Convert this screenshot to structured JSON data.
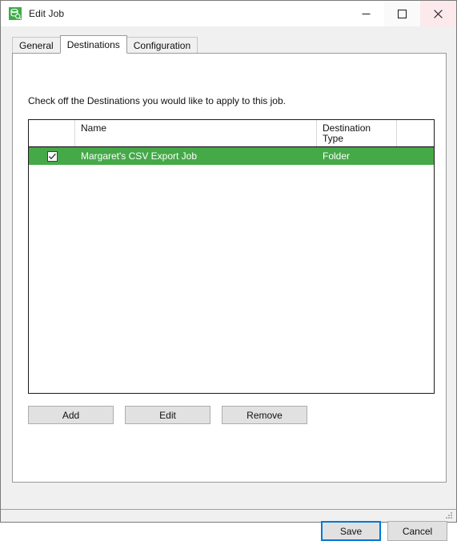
{
  "window": {
    "title": "Edit Job",
    "app_icon": "job-database-icon",
    "controls": {
      "minimize": "minimize-icon",
      "maximize": "maximize-icon",
      "close": "close-icon"
    }
  },
  "colors": {
    "accent_selection": "#45a948",
    "focus_border": "#0078d7",
    "close_hover": "#fbe9eb",
    "window_background": "#f0f0f0",
    "panel_background": "#ffffff"
  },
  "tabs": [
    {
      "label": "General",
      "active": false
    },
    {
      "label": "Destinations",
      "active": true
    },
    {
      "label": "Configuration",
      "active": false
    }
  ],
  "content": {
    "instruction": "Check off the Destinations you would like to apply to this job.",
    "grid": {
      "columns": [
        {
          "header": ""
        },
        {
          "header": "Name"
        },
        {
          "header": "Destination\nType"
        },
        {
          "header": ""
        }
      ],
      "rows": [
        {
          "checked": true,
          "name": "Margaret's CSV Export Job",
          "destination_type": "Folder",
          "selected": true
        }
      ]
    },
    "actions": [
      {
        "label": "Add"
      },
      {
        "label": "Edit"
      },
      {
        "label": "Remove"
      }
    ]
  },
  "footer": {
    "save_label": "Save",
    "cancel_label": "Cancel"
  }
}
